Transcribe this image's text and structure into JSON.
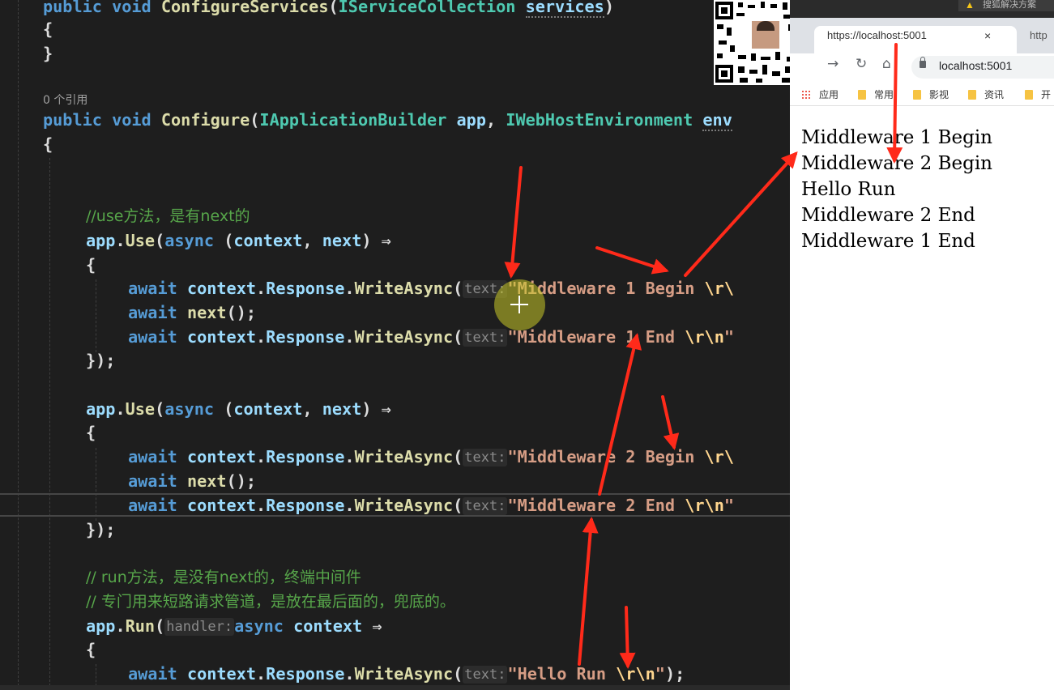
{
  "editor": {
    "references_label": "0 个引用",
    "lines": {
      "l1": {
        "k1": "public",
        "k2": "void",
        "fn": "ConfigureServices",
        "p1": "(",
        "ty": "IServiceCollection",
        "pa": "services",
        "p2": ")"
      },
      "l2": "{",
      "l3": "}",
      "l4": {
        "k1": "public",
        "k2": "void",
        "fn": "Configure",
        "p1": "(",
        "ty1": "IApplicationBuilder",
        "pa1": "app",
        "c1": ",",
        "ty2": "IWebHostEnvironment",
        "pa2": "env"
      },
      "l5": "{",
      "c1": "//use方法，是有next的",
      "u1": {
        "app": "app",
        "dot": ".",
        "fn": "Use",
        "p1": "(",
        "kw": "async",
        "p2": "(",
        "a1": "context",
        "c": ",",
        "a2": "next",
        "p3": ")",
        "arrow": "⇒"
      },
      "b1": "{",
      "w1": {
        "kw": "await",
        "obj": "context",
        "d1": ".",
        "prop": "Response",
        "d2": ".",
        "fn": "WriteAsync",
        "p1": "(",
        "hint": "text:",
        "str": "\"Middleware 1 Begin ",
        "esc": "\\r\\"
      },
      "n1": {
        "kw": "await",
        "fn": "next",
        "rest": "();"
      },
      "w2": {
        "kw": "await",
        "obj": "context",
        "d1": ".",
        "prop": "Response",
        "d2": ".",
        "fn": "WriteAsync",
        "p1": "(",
        "hint": "text:",
        "str": "\"Middleware 1 End ",
        "esc": "\\r\\n",
        "q": "\""
      },
      "e1": "});",
      "u2": {
        "app": "app",
        "dot": ".",
        "fn": "Use",
        "p1": "(",
        "kw": "async",
        "p2": "(",
        "a1": "context",
        "c": ",",
        "a2": "next",
        "p3": ")",
        "arrow": "⇒"
      },
      "b2": "{",
      "w3": {
        "kw": "await",
        "obj": "context",
        "d1": ".",
        "prop": "Response",
        "d2": ".",
        "fn": "WriteAsync",
        "p1": "(",
        "hint": "text:",
        "str": "\"Middleware 2 Begin ",
        "esc": "\\r\\"
      },
      "n2": {
        "kw": "await",
        "fn": "next",
        "rest": "();"
      },
      "w4": {
        "kw": "await",
        "obj": "context",
        "d1": ".",
        "prop": "Response",
        "d2": ".",
        "fn": "WriteAsync",
        "p1": "(",
        "hint": "text:",
        "str": "\"Middleware 2 End ",
        "esc": "\\r\\n",
        "q": "\""
      },
      "e2": "});",
      "c2": "// run方法，是没有next的，终端中间件",
      "c3": "// 专门用来短路请求管道，是放在最后面的，兜底的。",
      "r1": {
        "app": "app",
        "dot": ".",
        "fn": "Run",
        "p1": "(",
        "hint": "handler:",
        "kw": "async",
        "a1": "context",
        "arrow": "⇒"
      },
      "b3": "{",
      "w5": {
        "kw": "await",
        "obj": "context",
        "d1": ".",
        "prop": "Response",
        "d2": ".",
        "fn": "WriteAsync",
        "p1": "(",
        "hint": "text:",
        "str": "\"Hello Run ",
        "esc": "\\r\\n",
        "q": "\"",
        "end": ");"
      }
    }
  },
  "browser": {
    "search_hint": "搜狐解决方案",
    "tab_title": "https://localhost:5001",
    "tab_close": "×",
    "tab2_title": "http",
    "url": "localhost:5001",
    "bookmarks": [
      {
        "label": "应用"
      },
      {
        "label": "常用"
      },
      {
        "label": "影视"
      },
      {
        "label": "资讯"
      },
      {
        "label": "开"
      }
    ],
    "output_lines": [
      "Middleware 1 Begin",
      "Middleware 2 Begin",
      "Hello Run",
      "Middleware 2 End",
      "Middleware 1 End"
    ]
  },
  "colors": {
    "annotation_arrow": "#ff2a1a",
    "editor_bg": "#1e1e1e",
    "keyword": "#569cd6",
    "type": "#4ec9b0",
    "function": "#dcdcaa",
    "parameter": "#9cdcfe",
    "string": "#d69d85",
    "comment": "#57a64a"
  }
}
